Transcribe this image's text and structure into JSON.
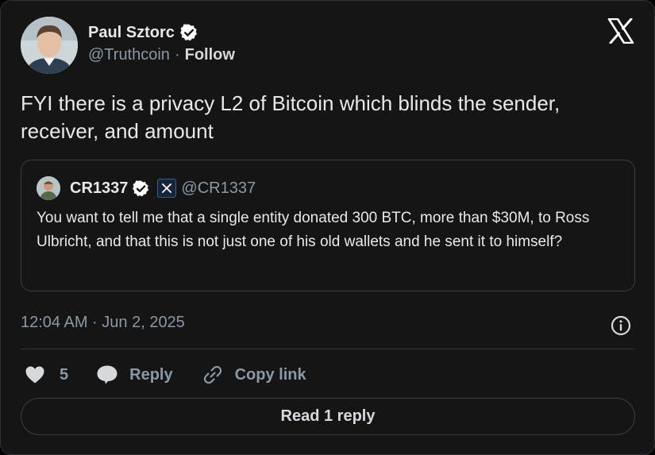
{
  "author": {
    "name": "Paul Sztorc",
    "handle": "@Truthcoin",
    "separator": "·",
    "follow_label": "Follow"
  },
  "tweet": {
    "text": "FYI there is a privacy L2 of Bitcoin which blinds the sender, receiver, and amount",
    "timestamp": "12:04 AM · Jun 2, 2025"
  },
  "quote": {
    "name": "CR1337",
    "handle": "@CR1337",
    "text": "You want to tell me that a single entity donated 300 BTC, more than $30M, to Ross Ulbricht, and that this is not just one of his old wallets and he sent it to himself?"
  },
  "actions": {
    "like_count": "5",
    "reply_label": "Reply",
    "copy_label": "Copy link",
    "read_replies_label": "Read 1 reply"
  },
  "icons": {
    "logo": "x-logo-icon",
    "verified": "verified-badge-icon",
    "affiliate": "x-affiliate-badge-icon",
    "info": "info-icon",
    "like": "heart-icon",
    "reply": "speech-bubble-icon",
    "copy": "link-icon"
  },
  "colors": {
    "background": "#151515",
    "text_primary": "#e7e9ea",
    "text_secondary": "#8b98a5",
    "border": "#2f3336"
  }
}
